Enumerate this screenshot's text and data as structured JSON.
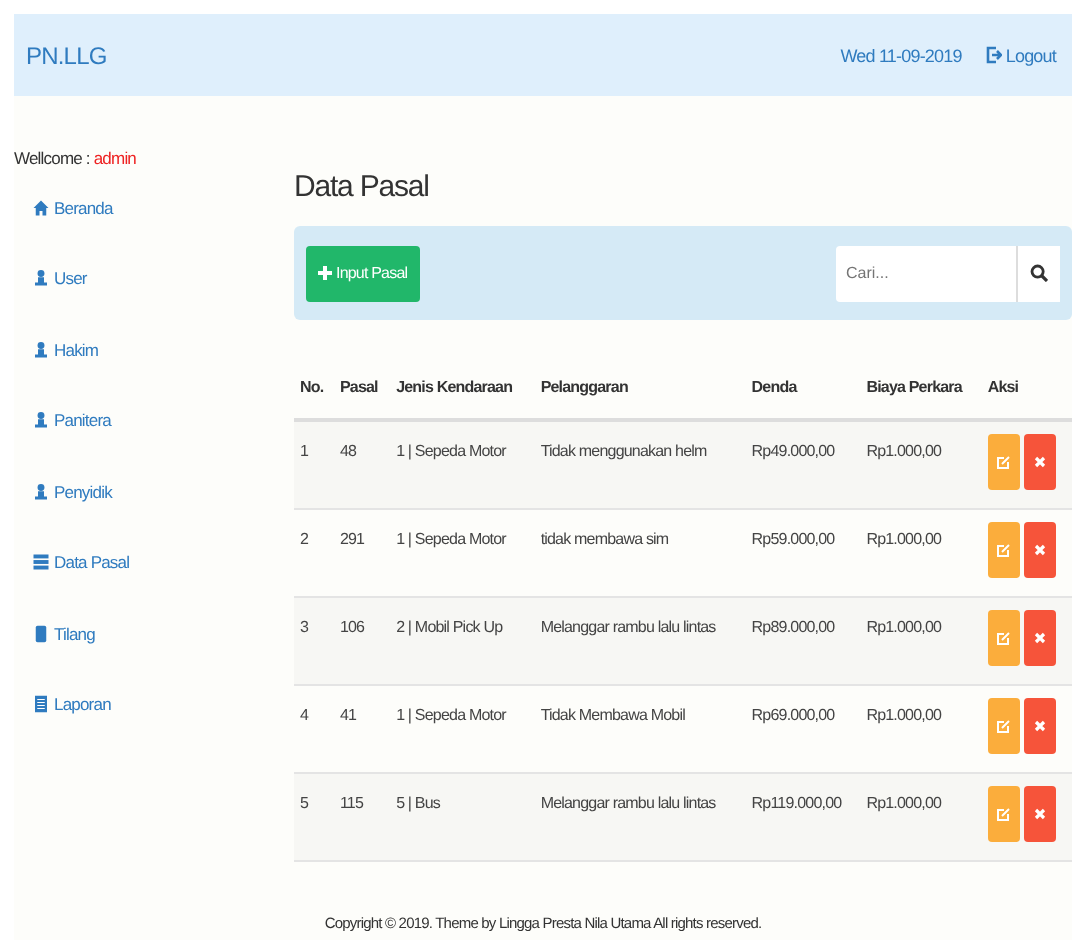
{
  "navbar": {
    "brand": "PN.LLG",
    "date": "Wed 11-09-2019",
    "logout": "Logout"
  },
  "sidebar": {
    "welcome_label": "Wellcome :",
    "user": "admin",
    "items": [
      {
        "label": "Beranda",
        "kind": "home"
      },
      {
        "label": "User",
        "kind": "person"
      },
      {
        "label": "Hakim",
        "kind": "person"
      },
      {
        "label": "Panitera",
        "kind": "person"
      },
      {
        "label": "Penyidik",
        "kind": "person"
      },
      {
        "label": "Data Pasal",
        "kind": "table"
      },
      {
        "label": "Tilang",
        "kind": "phone"
      },
      {
        "label": "Laporan",
        "kind": "document"
      }
    ]
  },
  "page_title": "Data Pasal",
  "toolbar": {
    "add_button": "Input Pasal",
    "search": {
      "placeholder": "Cari..."
    }
  },
  "table": {
    "columns": [
      "No.",
      "Pasal",
      "Jenis Kendaraan",
      "Pelanggaran",
      "Denda",
      "Biaya Perkara",
      "Aksi"
    ],
    "rows": [
      [
        "1",
        "48",
        "1 | Sepeda Motor",
        "Tidak menggunakan helm",
        "Rp49.000,00",
        "Rp1.000,00"
      ],
      [
        "2",
        "291",
        "1 | Sepeda Motor",
        "tidak membawa sim",
        "Rp59.000,00",
        "Rp1.000,00"
      ],
      [
        "3",
        "106",
        "2 | Mobil Pick Up",
        "Melanggar rambu lalu lintas",
        "Rp89.000,00",
        "Rp1.000,00"
      ],
      [
        "4",
        "41",
        "1 | Sepeda Motor",
        "Tidak Membawa Mobil",
        "Rp69.000,00",
        "Rp1.000,00"
      ],
      [
        "5",
        "115",
        "5 | Bus",
        "Melanggar rambu lalu lintas",
        "Rp119.000,00",
        "Rp1.000,00"
      ]
    ]
  },
  "footer": "Copyright © 2019. Theme by Lingga Presta Nila Utama All rights reserved."
}
